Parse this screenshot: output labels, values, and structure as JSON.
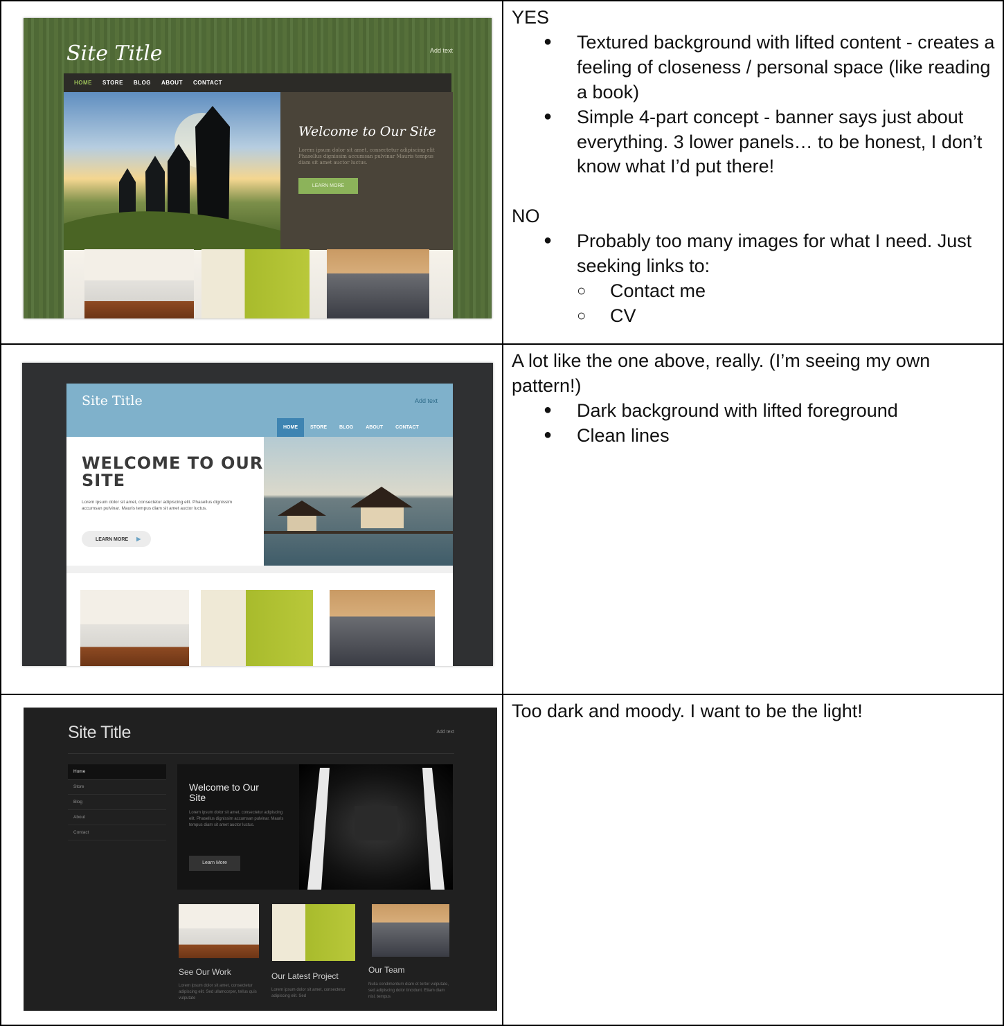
{
  "rows": [
    {
      "mock": {
        "site_title": "Site Title",
        "add_text": "Add text",
        "nav": [
          "HOME",
          "STORE",
          "BLOG",
          "ABOUT",
          "CONTACT"
        ],
        "hero_heading": "Welcome to Our Site",
        "hero_body": "Lorem ipsum dolor sit amet, consectetur adipiscing elit Phasellus dignissim accumsan pulvinar Mauris tempus diam sit amet auctor luctus.",
        "button": "LEARN MORE"
      },
      "notes": {
        "yes_heading": "YES",
        "yes_bullets": [
          "Textured background with lifted content - creates a feeling of closeness / personal space (like reading a book)",
          "Simple 4-part concept - banner says just about everything.  3 lower panels… to be honest, I don’t know what I’d put there!"
        ],
        "no_heading": "NO",
        "no_bullets": [
          "Probably too many images for what I need. Just seeking links to:"
        ],
        "no_sub_bullets": [
          "Contact me",
          "CV"
        ]
      }
    },
    {
      "mock": {
        "site_title": "Site Title",
        "add_text": "Add text",
        "nav": [
          "HOME",
          "STORE",
          "BLOG",
          "ABOUT",
          "CONTACT"
        ],
        "hero_heading_line1": "WELCOME TO OUR",
        "hero_heading_line2": "SITE",
        "hero_body": "Lorem ipsum dolor sit amet, consectetur adipiscing elit. Phasellus dignissim accumsan pulvinar. Mauris tempus diam sit amet auctor luctus.",
        "button": "LEARN MORE"
      },
      "notes": {
        "intro": "A lot like the one above, really.  (I’m seeing my own pattern!)",
        "bullets": [
          "Dark background with lifted foreground",
          "Clean lines"
        ]
      }
    },
    {
      "mock": {
        "site_title": "Site Title",
        "add_text": "Add text",
        "nav": [
          "Home",
          "Store",
          "Blog",
          "About",
          "Contact"
        ],
        "hero_heading": "Welcome to Our Site",
        "hero_body": "Lorem ipsum dolor sit amet, consectetur adipiscing elit. Phasellus dignissim accumsan pulvinar. Mauris tempus diam sit amet auctor luctus.",
        "button": "Learn More",
        "cards": [
          {
            "title": "See Our Work",
            "body": "Lorem ipsum dolor sit amet, consectetur adipiscing elit. Sed ullamcorper, tellus quis vulputate"
          },
          {
            "title": "Our Latest Project",
            "body": "Lorem ipsum dolor sit amet, consectetur adipiscing elit. Sed"
          },
          {
            "title": "Our Team",
            "body": "Nulla condimentum diam et tortor vulputate, sed adipiscing dolor tincidunt. Etiam diam nisl, tempus"
          }
        ]
      },
      "notes": {
        "text": "Too dark and moody.  I want to be the light!"
      }
    }
  ]
}
